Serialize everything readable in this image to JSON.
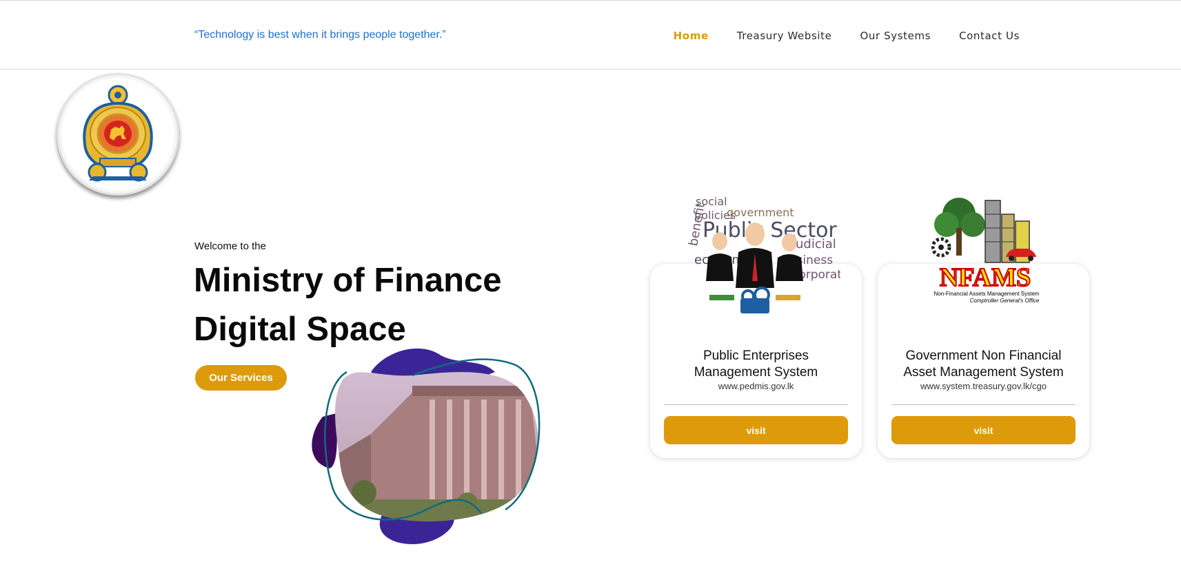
{
  "header": {
    "tagline": "“Technology is best when it brings people together.”",
    "nav": [
      {
        "label": "Home",
        "active": true
      },
      {
        "label": "Treasury Website",
        "active": false
      },
      {
        "label": "Our Systems",
        "active": false
      },
      {
        "label": "Contact Us",
        "active": false
      }
    ]
  },
  "hero": {
    "welcome": "Welcome to the",
    "title_line1": "Ministry of Finance",
    "title_line2": "Digital Space",
    "button_label": "Our Services"
  },
  "cards": [
    {
      "title_line1": "Public Enterprises",
      "title_line2": "Management System",
      "url": "www.pedmis.gov.lk",
      "button_label": "visit",
      "image_icon": "public-sector-word-cloud-icon",
      "image_words": [
        "social",
        "policies",
        "government",
        "Public Sector",
        "benefit",
        "judicial",
        "corporate",
        "business",
        "economy"
      ]
    },
    {
      "title_line1": "Government Non Financial",
      "title_line2": "Asset Management System",
      "url": "www.system.treasury.gov.lk/cgo",
      "button_label": "visit",
      "image_icon": "nfams-logo-icon",
      "logo_text": "NFAMS",
      "logo_sub1": "Non-Financial Assets Management System",
      "logo_sub2": "Comptroller General's Office"
    }
  ],
  "colors": {
    "accent": "#dd9a0b",
    "tagline": "#1e6fd0",
    "blob_purple": "#3b2596",
    "outline_teal": "#0e6b7a"
  }
}
